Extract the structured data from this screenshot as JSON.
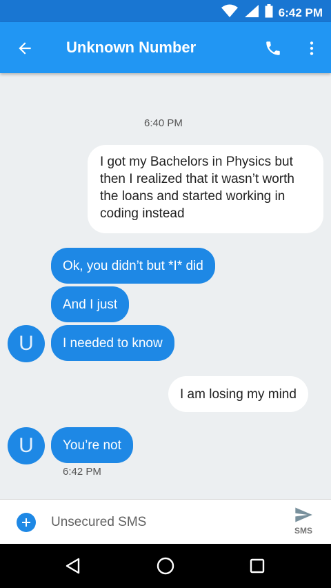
{
  "status_bar": {
    "time": "6:42 PM",
    "icons": [
      "wifi-icon",
      "signal-icon",
      "battery-icon"
    ]
  },
  "app_bar": {
    "title": "Unknown Number",
    "icons": [
      "back-arrow-icon",
      "phone-icon",
      "more-vert-icon"
    ]
  },
  "conversation": {
    "timestamps": [
      "6:40 PM",
      "6:42 PM"
    ],
    "messages": [
      {
        "direction": "outgoing",
        "text": "I got my Bachelors in Physics but then I realized that it wasn’t worth the loans and started working in coding instead"
      },
      {
        "direction": "incoming",
        "text": "Ok, you didn’t but *I* did"
      },
      {
        "direction": "incoming",
        "text": "And I just"
      },
      {
        "direction": "incoming",
        "text": "I needed to know"
      },
      {
        "direction": "outgoing",
        "text": "I am losing my mind"
      },
      {
        "direction": "incoming",
        "text": "You’re not"
      }
    ],
    "avatar_letter": "U"
  },
  "compose": {
    "placeholder": "Unsecured SMS",
    "send_label": "SMS"
  },
  "nav_bar": {
    "icons": [
      "back-triangle-icon",
      "home-circle-icon",
      "recents-square-icon"
    ]
  },
  "colors": {
    "primary": "#2196f3",
    "primary_dark": "#1976d2",
    "incoming_bubble": "#1e88e5",
    "outgoing_bubble": "#ffffff",
    "background": "#eceff1"
  }
}
